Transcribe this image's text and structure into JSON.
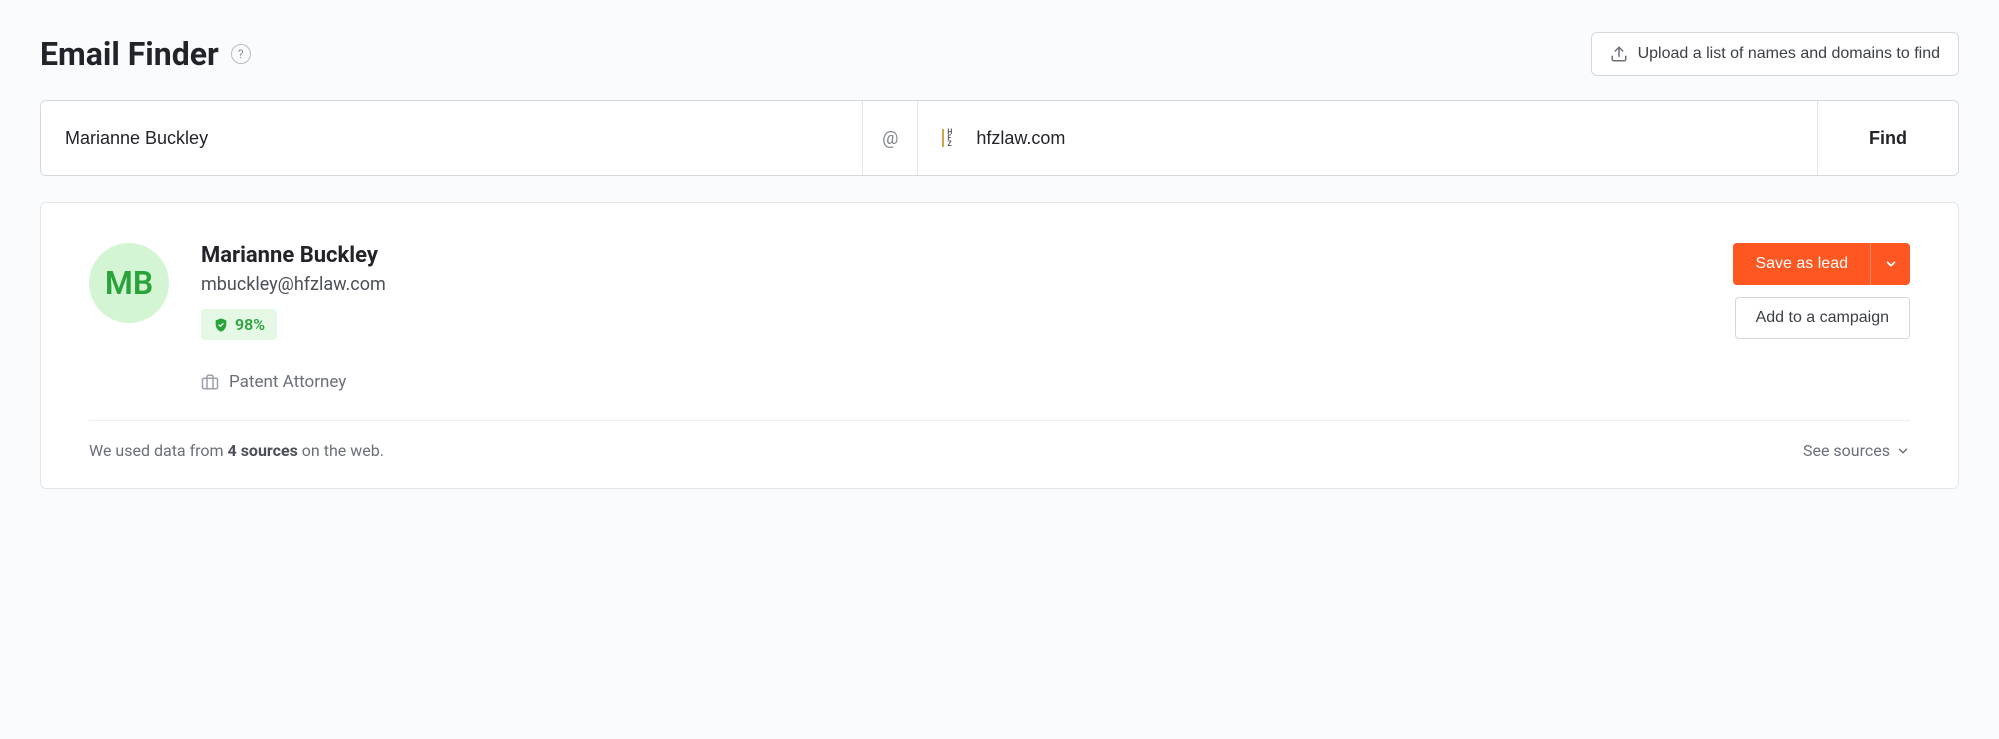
{
  "header": {
    "title": "Email Finder",
    "upload_label": "Upload a list of names and domains to find"
  },
  "search": {
    "name_value": "Marianne Buckley",
    "at_symbol": "@",
    "domain_value": "hfzlaw.com",
    "find_label": "Find"
  },
  "result": {
    "avatar_initials": "MB",
    "name": "Marianne Buckley",
    "email": "mbuckley@hfzlaw.com",
    "confidence": "98%",
    "job_title": "Patent Attorney",
    "save_lead_label": "Save as lead",
    "add_campaign_label": "Add to a campaign"
  },
  "footer": {
    "sources_prefix": "We used data from ",
    "sources_bold": "4 sources",
    "sources_suffix": " on the web.",
    "see_sources_label": "See sources"
  }
}
